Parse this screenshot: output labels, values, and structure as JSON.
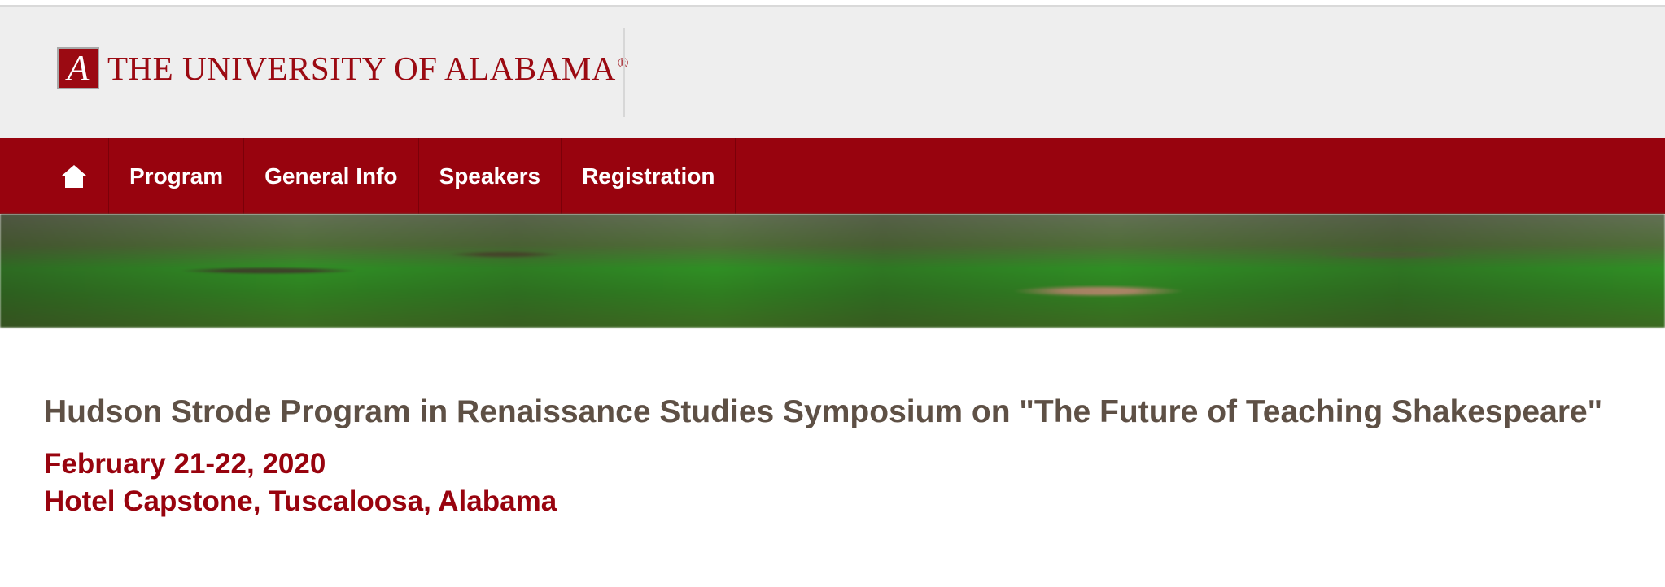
{
  "header": {
    "logo_mark": "A",
    "logo_text": "THE UNIVERSITY OF ALABAMA",
    "logo_registered": "®"
  },
  "nav": {
    "home_icon": "home-icon",
    "items": [
      {
        "label": "Program"
      },
      {
        "label": "General Info"
      },
      {
        "label": "Speakers"
      },
      {
        "label": "Registration"
      }
    ]
  },
  "hero": {
    "description": "Blurred campus trees and lawn banner"
  },
  "event": {
    "title": "Hudson Strode Program in Renaissance Studies Symposium on \"The Future of Teaching Shakespeare\"",
    "date": "February 21-22, 2020",
    "location": "Hotel Capstone, Tuscaloosa, Alabama"
  },
  "colors": {
    "brand": "#98030e",
    "header_background": "#eeeeee",
    "title_text": "#5e5045"
  }
}
